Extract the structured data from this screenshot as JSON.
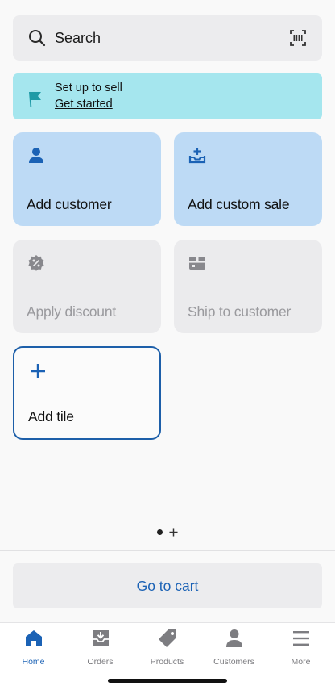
{
  "search": {
    "label": "Search"
  },
  "banner": {
    "title": "Set up to sell",
    "link": "Get started"
  },
  "tiles": [
    {
      "label": "Add customer",
      "icon": "person-icon"
    },
    {
      "label": "Add custom sale",
      "icon": "tray-add-icon"
    },
    {
      "label": "Apply discount",
      "icon": "discount-icon"
    },
    {
      "label": "Ship to customer",
      "icon": "shipping-box-icon"
    },
    {
      "label": "Add tile",
      "icon": "plus-icon"
    }
  ],
  "cart": {
    "label": "Go to cart"
  },
  "tabs": [
    {
      "label": "Home",
      "icon": "home-icon",
      "active": true
    },
    {
      "label": "Orders",
      "icon": "orders-icon"
    },
    {
      "label": "Products",
      "icon": "tag-icon"
    },
    {
      "label": "Customers",
      "icon": "person-icon"
    },
    {
      "label": "More",
      "icon": "menu-icon"
    }
  ],
  "colors": {
    "accent": "#1b62b5",
    "banner": "#a5e6ee",
    "tile_blue": "#bddaf5",
    "tile_gray": "#ebebed",
    "flag": "#1f9aa6"
  }
}
